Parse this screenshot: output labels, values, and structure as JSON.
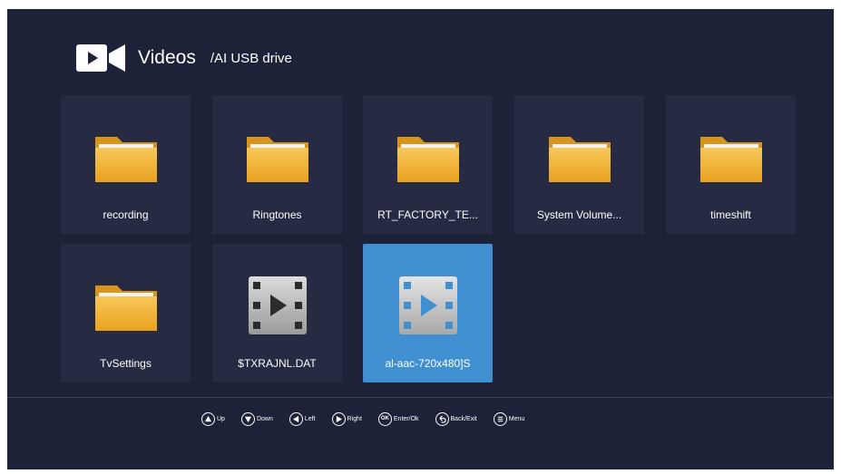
{
  "header": {
    "title": "Videos",
    "path": "/AI USB drive"
  },
  "items": [
    {
      "label": "recording",
      "type": "folder",
      "selected": false
    },
    {
      "label": "Ringtones",
      "type": "folder",
      "selected": false
    },
    {
      "label": "RT_FACTORY_TE...",
      "type": "folder",
      "selected": false
    },
    {
      "label": "System Volume...",
      "type": "folder",
      "selected": false
    },
    {
      "label": "timeshift",
      "type": "folder",
      "selected": false
    },
    {
      "label": "TvSettings",
      "type": "folder",
      "selected": false
    },
    {
      "label": "$TXRAJNL.DAT",
      "type": "video-file",
      "selected": false
    },
    {
      "label": "al-aac-720x480]S",
      "type": "video-file",
      "selected": true
    }
  ],
  "hints": [
    {
      "label": "Up",
      "icon": "up-key-icon"
    },
    {
      "label": "Down",
      "icon": "down-key-icon"
    },
    {
      "label": "Left",
      "icon": "left-key-icon"
    },
    {
      "label": "Right",
      "icon": "right-key-icon"
    },
    {
      "label": "Enter/Ok",
      "icon": "ok-key-icon",
      "key_text": "OK"
    },
    {
      "label": "Back/Exit",
      "icon": "back-key-icon"
    },
    {
      "label": "Menu",
      "icon": "menu-key-icon"
    }
  ],
  "colors": {
    "background": "#1d2238",
    "tile": "#262b43",
    "selected_tile": "#3f8fd1",
    "folder": "#f4b63a",
    "text": "#ffffff"
  }
}
